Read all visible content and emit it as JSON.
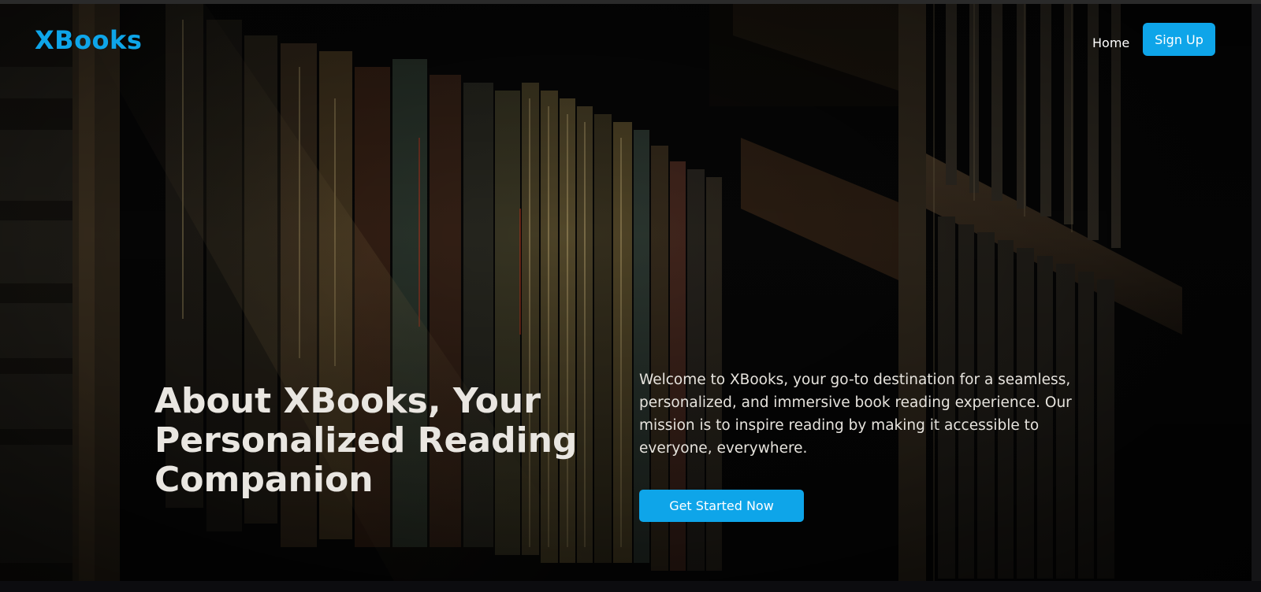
{
  "navbar": {
    "logo": "XBooks",
    "home_label": "Home",
    "signup_label": "Sign Up"
  },
  "hero": {
    "title": "About XBooks, Your Personalized Reading Companion",
    "description": "Welcome to XBooks, your go-to destination for a seamless, personalized, and immersive book reading experience. Our mission is to inspire reading by making it accessible to everyone, everywhere.",
    "cta_label": "Get Started Now",
    "background_image_alt": "dimly lit bookshelf with book spines"
  },
  "colors": {
    "accent": "#0ea5e9",
    "text_light": "#e9e6e1",
    "background": "#0a0a0c"
  }
}
